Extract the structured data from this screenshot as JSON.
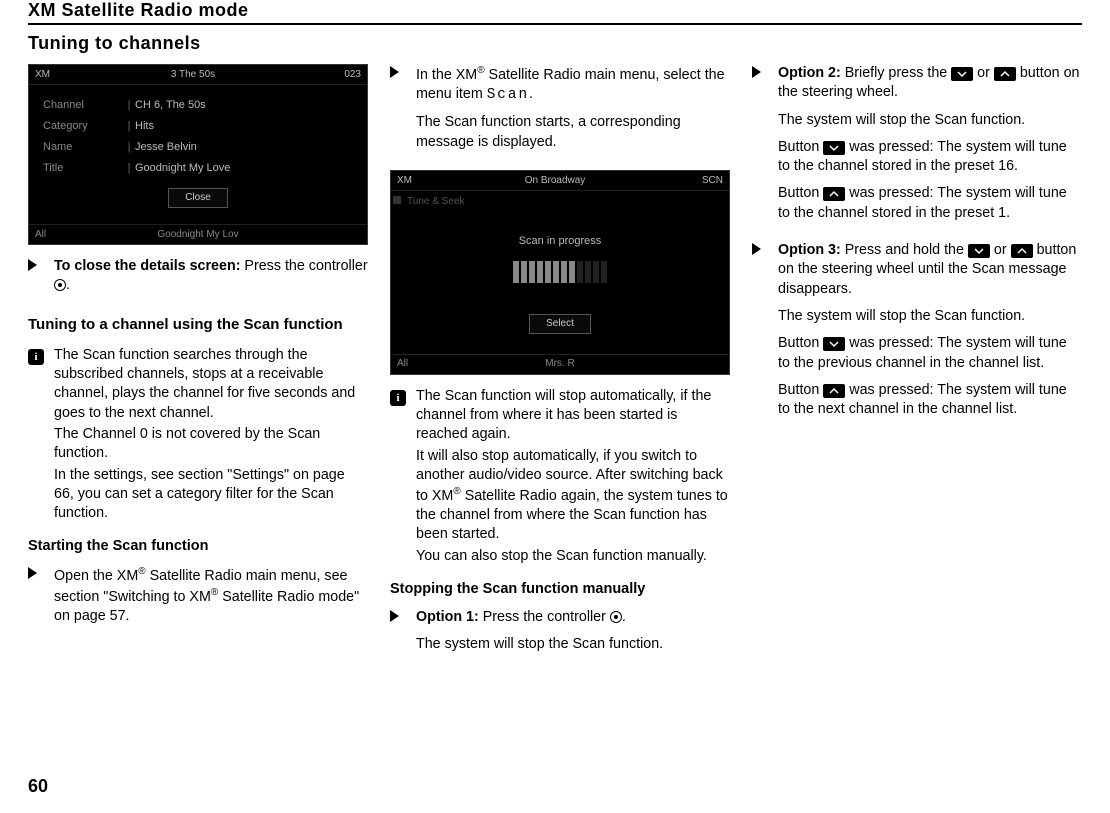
{
  "chapter_title": "XM Satellite Radio mode",
  "section_title": "Tuning to channels",
  "page_number": "60",
  "screenshot1": {
    "brand": "XM",
    "top_center": "3    The 50s",
    "top_right": "023",
    "rows": [
      {
        "label": "Channel",
        "value": "CH 6, The 50s"
      },
      {
        "label": "Category",
        "value": "Hits"
      },
      {
        "label": "Name",
        "value": "Jesse Belvin"
      },
      {
        "label": "Title",
        "value": "Goodnight My Love"
      }
    ],
    "button": "Close",
    "foot_left": "All",
    "foot_center": "Goodnight My Lov",
    "foot_right": ""
  },
  "col1": {
    "close_details_bold": "To close the details screen:",
    "close_details_rest": " Press the controller ",
    "close_details_end": ".",
    "subheading": "Tuning to a channel using the Scan function",
    "info": [
      "The Scan function searches through the subscribed channels, stops at a receivable channel, plays the channel for five seconds and goes to the next channel.",
      "The Channel 0 is not covered by the Scan function.",
      "In the settings, see section \"Settings\" on page 66, you can set a category filter for the Scan function."
    ],
    "subsub": "Starting the Scan function",
    "start_step_pre": "Open the XM",
    "start_step_mid": " Satellite Radio main menu, see section \"Switching to XM",
    "start_step_end": " Satellite Radio mode\" on page 57."
  },
  "col2": {
    "step1_pre": "In the XM",
    "step1_mid": " Satellite Radio main menu, select the menu item ",
    "step1_scan": "Scan",
    "step1_end": ".",
    "step1_p2": "The Scan function starts, a corresponding message is displayed.",
    "shot": {
      "brand": "XM",
      "top_center": "On Broadway",
      "top_right": "SCN",
      "subline": "Tune & Seek",
      "message": "Scan in progress",
      "button": "Select",
      "foot_left": "All",
      "foot_center": "Mrs. R"
    },
    "info": [
      "The Scan function will stop automatically, if the channel from where it has been started is reached again.",
      "It will also stop automatically, if you switch to another audio/video source. After switching back to XM® Satellite Radio again, the system tunes to the channel from where the Scan function has been started.",
      "You can also stop the Scan function manually."
    ],
    "info_pre": "It will also stop automatically, if you switch to another audio/video source. After switching back to XM",
    "info_post": " Satellite Radio again, the system tunes to the channel from where the Scan function has been started.",
    "subsub": "Stopping the Scan function manually",
    "opt1_bold": "Option 1:",
    "opt1_rest": " Press the controller ",
    "opt1_end": ".",
    "opt1_p2": "The system will stop the Scan function."
  },
  "col3": {
    "opt2_bold": "Option 2:",
    "opt2_pre": " Briefly press the ",
    "opt2_mid": " or ",
    "opt2_post": " button on the steering wheel.",
    "opt2_p2": "The system will stop the Scan function.",
    "opt2_p3_pre": "Button ",
    "opt2_p3_post": " was pressed: The system will tune to the channel stored in the preset 16.",
    "opt2_p4_pre": "Button ",
    "opt2_p4_post": " was pressed: The system will tune to the channel stored in the preset 1.",
    "opt3_bold": "Option 3:",
    "opt3_pre": " Press and hold the ",
    "opt3_mid": " or ",
    "opt3_post": " button on the steering wheel until the Scan message disappears.",
    "opt3_p2": "The system will stop the Scan function.",
    "opt3_p3_pre": "Button ",
    "opt3_p3_post": " was pressed: The system will tune to the previous channel in the channel list.",
    "opt3_p4_pre": "Button ",
    "opt3_p4_post": " was pressed: The system will tune to the next channel in the channel list."
  }
}
